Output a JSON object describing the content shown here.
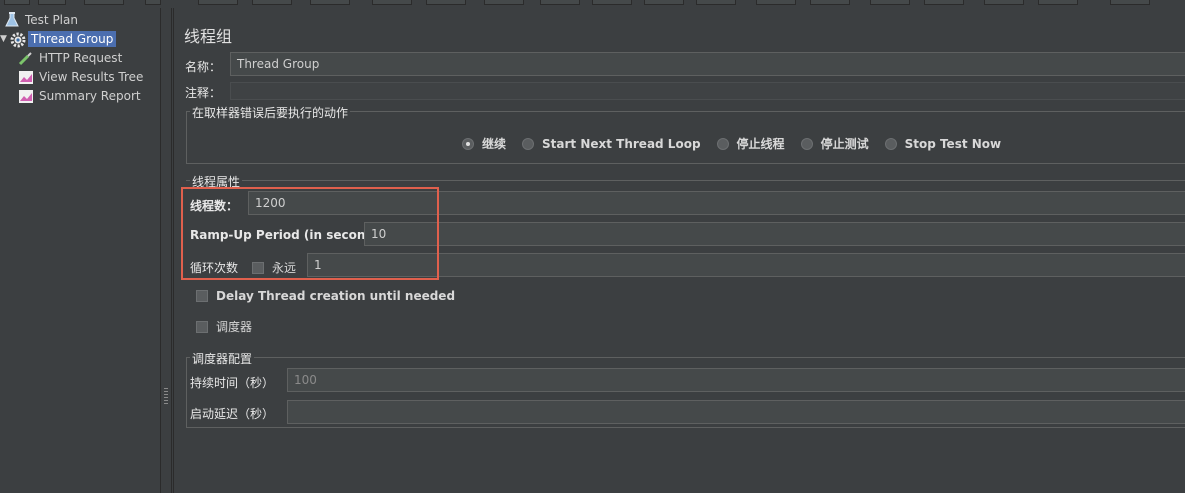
{
  "tree": {
    "items": [
      {
        "label": "Test Plan",
        "icon": "flask-icon"
      },
      {
        "label": "Thread Group",
        "icon": "gear-icon"
      },
      {
        "label": "HTTP Request",
        "icon": "pipette-icon"
      },
      {
        "label": "View Results Tree",
        "icon": "chart-icon"
      },
      {
        "label": "Summary Report",
        "icon": "chart-icon"
      }
    ]
  },
  "panel": {
    "title": "线程组",
    "name_label": "名称：",
    "name_value": "Thread Group",
    "comment_label": "注释：",
    "comment_value": ""
  },
  "error_action": {
    "legend": "在取样器错误后要执行的动作",
    "options": [
      "继续",
      "Start Next Thread Loop",
      "停止线程",
      "停止测试",
      "Stop Test Now"
    ],
    "selected": "继续"
  },
  "thread_props": {
    "legend": "线程属性",
    "threads_label": "线程数：",
    "threads_value": "1200",
    "rampup_label": "Ramp-Up Period (in seconds):",
    "rampup_value": "10",
    "loop_label": "循环次数",
    "forever_label": "永远",
    "loop_value": "1",
    "delay_label": "Delay Thread creation until needed",
    "scheduler_label": "调度器"
  },
  "scheduler": {
    "legend": "调度器配置",
    "duration_label": "持续时间（秒）",
    "duration_value": "100",
    "delay_label": "启动延迟（秒）",
    "delay_value": ""
  },
  "colors": {
    "background": "#3c3f41",
    "selection": "#4b6eaf",
    "highlight_box": "#e0604d"
  }
}
